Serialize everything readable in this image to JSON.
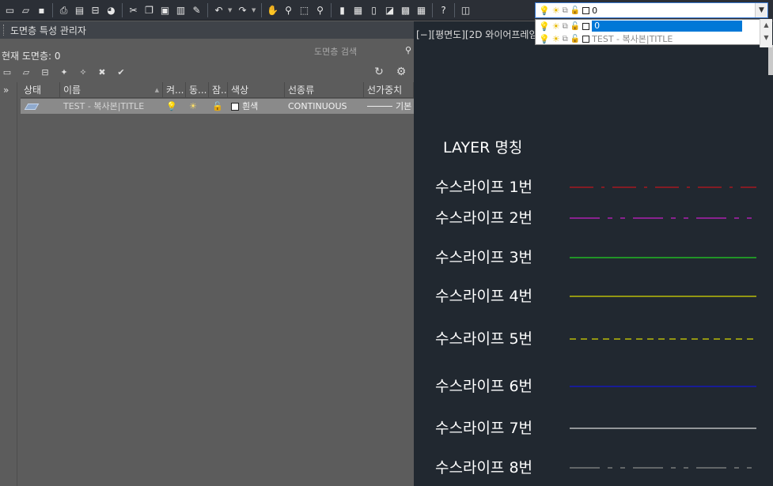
{
  "toolbar": {
    "icons": [
      "new-file-icon",
      "open-file-icon",
      "save-icon",
      "print-icon",
      "print-preview-icon",
      "plot-icon",
      "publish-icon",
      "cut-icon",
      "copy-icon",
      "paste-icon",
      "paste-block-icon",
      "match-properties-icon",
      "undo-icon",
      "redo-icon",
      "pan-icon",
      "zoom-realtime-icon",
      "zoom-window-icon",
      "zoom-previous-icon",
      "properties-icon",
      "design-center-icon",
      "tool-palettes-icon",
      "sheet-set-icon",
      "markup-icon",
      "calculator-icon",
      "help-icon",
      "layer-properties-icon"
    ]
  },
  "layer_combo": {
    "current": "0",
    "items": [
      {
        "name": "0",
        "selected": true
      },
      {
        "name": "TEST - 복사본|TITLE",
        "selected": false
      }
    ]
  },
  "panel": {
    "title": "도면층 특성 관리자",
    "current_layer": "현재 도면층: 0",
    "search_placeholder": "도면층 검색",
    "side_toggle": "»",
    "columns": [
      "상태",
      "이름",
      "켜...",
      "동...",
      "잠...",
      "색상",
      "선종류",
      "선가중치"
    ],
    "rows": [
      {
        "name": "TEST - 복사본|TITLE",
        "color": "흰색",
        "linetype": "CONTINUOUS",
        "lineweight": "기본"
      }
    ]
  },
  "canvas": {
    "viewport_label": "[−][평면도][2D 와이어프레임]",
    "legend_title": "LAYER 명칭",
    "items": [
      {
        "label": "수스라이프 1번",
        "color": "#c0141e",
        "style": "dashdot"
      },
      {
        "label": "수스라이프 2번",
        "color": "#c81ec8",
        "style": "dashdot2"
      },
      {
        "label": "수스라이프 3번",
        "color": "#22d422",
        "style": "solid"
      },
      {
        "label": "수스라이프 4번",
        "color": "#d8d800",
        "style": "solid"
      },
      {
        "label": "수스라이프 5번",
        "color": "#d8d800",
        "style": "dashed"
      },
      {
        "label": "수스라이프 6번",
        "color": "#1414d2",
        "style": "solid"
      },
      {
        "label": "수스라이프 7번",
        "color": "#d8d8d8",
        "style": "solid"
      },
      {
        "label": "수스라이프 8번",
        "color": "#8a8a8a",
        "style": "dashdot2"
      }
    ]
  }
}
